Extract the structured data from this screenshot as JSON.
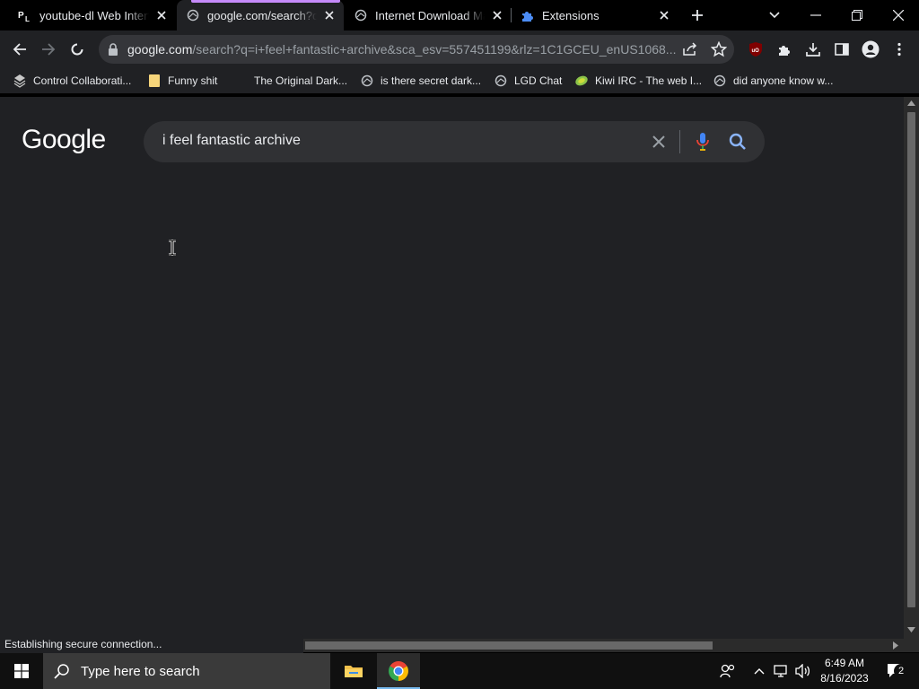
{
  "tabs": [
    {
      "favicon": "pl-favicon",
      "title": "youtube-dl Web Interface",
      "active": false
    },
    {
      "favicon": "globe-icon",
      "title": "google.com/search?q=i+feel+fantastic+archive",
      "active": true
    },
    {
      "favicon": "globe-icon",
      "title": "Internet Download Manager",
      "active": false
    },
    {
      "favicon": "puzzle-icon",
      "title": "Extensions",
      "active": false
    }
  ],
  "toolbar": {
    "url_host": "google.com",
    "url_path": "/search?q=i+feel+fantastic+archive&sca_esv=557451199&rlz=1C1GCEU_enUS1068..."
  },
  "bookmarks": [
    {
      "icon": "control-collab-icon",
      "label": "Control Collaborati..."
    },
    {
      "icon": "folder-icon",
      "label": "Funny shit"
    },
    {
      "icon": "none",
      "label": "The Original Dark..."
    },
    {
      "icon": "globe-icon",
      "label": "is there secret dark..."
    },
    {
      "icon": "globe-icon",
      "label": "LGD Chat"
    },
    {
      "icon": "kiwi-icon",
      "label": "Kiwi IRC - The web I..."
    },
    {
      "icon": "globe-icon",
      "label": "did anyone know w..."
    }
  ],
  "page": {
    "logo": "Google",
    "query": "i feel fantastic archive"
  },
  "status": "Establishing secure connection...",
  "taskbar": {
    "search_placeholder": "Type here to search",
    "time": "6:49 AM",
    "date": "8/16/2023",
    "notification_count": "2"
  },
  "colors": {
    "page_bg": "#202124",
    "searchbox_bg": "#303134",
    "loading_accent": "#c58af9",
    "tab_strip": "#000000"
  }
}
